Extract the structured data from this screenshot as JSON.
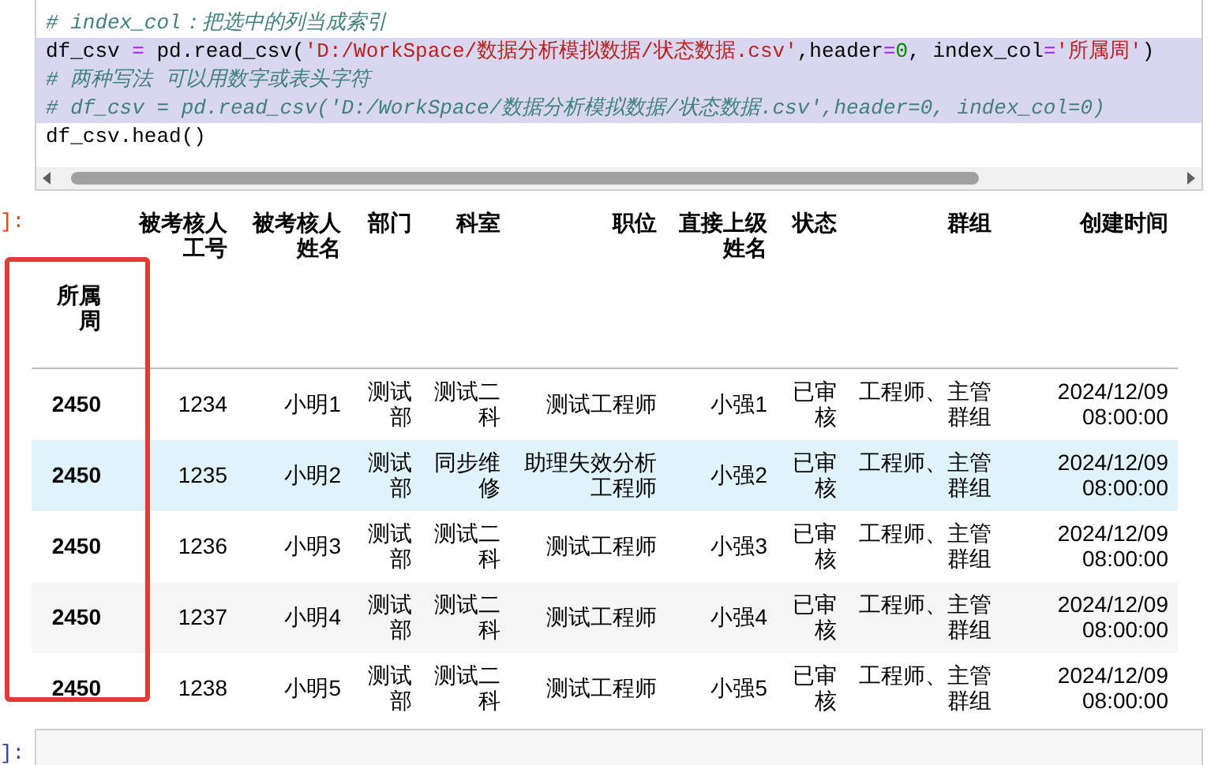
{
  "code_cell": {
    "lines": [
      {
        "selected": false,
        "tokens": [
          {
            "kind": "comment",
            "text": "# index_col：把选中的列当成索引"
          }
        ]
      },
      {
        "selected": true,
        "tokens": [
          {
            "kind": "plain",
            "text": "df_csv "
          },
          {
            "kind": "operator",
            "text": "="
          },
          {
            "kind": "plain",
            "text": " pd.read_csv("
          },
          {
            "kind": "string",
            "text": "'D:/WorkSpace/数据分析模拟数据/状态数据.csv'"
          },
          {
            "kind": "plain",
            "text": ",header"
          },
          {
            "kind": "operator",
            "text": "="
          },
          {
            "kind": "number",
            "text": "0"
          },
          {
            "kind": "plain",
            "text": ", index_col"
          },
          {
            "kind": "operator",
            "text": "="
          },
          {
            "kind": "string",
            "text": "'所属周'"
          },
          {
            "kind": "plain",
            "text": ")"
          }
        ]
      },
      {
        "selected": true,
        "tokens": [
          {
            "kind": "comment",
            "text": "# 两种写法 可以用数字或表头字符"
          }
        ]
      },
      {
        "selected": true,
        "tokens": [
          {
            "kind": "comment",
            "text": "# df_csv = pd.read_csv('D:/WorkSpace/数据分析模拟数据/状态数据.csv',header=0, index_col=0)"
          }
        ]
      },
      {
        "selected": false,
        "tokens": [
          {
            "kind": "plain",
            "text": "df_csv.head()"
          }
        ]
      }
    ]
  },
  "output": {
    "prompt": "]:",
    "table": {
      "columns": [
        "被考核人工号",
        "被考核人姓名",
        "部门",
        "科室",
        "职位",
        "直接上级姓名",
        "状态",
        "群组",
        "创建时间"
      ],
      "index_name": "所属周",
      "rows": [
        {
          "index": "2450",
          "selected": false,
          "cells": [
            "1234",
            "小明1",
            "测试部",
            "测试二科",
            "测试工程师",
            "小强1",
            "已审核",
            "工程师、主管群组",
            "2024/12/09 08:00:00"
          ]
        },
        {
          "index": "2450",
          "selected": true,
          "cells": [
            "1235",
            "小明2",
            "测试部",
            "同步维修",
            "助理失效分析工程师",
            "小强2",
            "已审核",
            "工程师、主管群组",
            "2024/12/09 08:00:00"
          ]
        },
        {
          "index": "2450",
          "selected": false,
          "cells": [
            "1236",
            "小明3",
            "测试部",
            "测试二科",
            "测试工程师",
            "小强3",
            "已审核",
            "工程师、主管群组",
            "2024/12/09 08:00:00"
          ]
        },
        {
          "index": "2450",
          "selected": false,
          "cells": [
            "1237",
            "小明4",
            "测试部",
            "测试二科",
            "测试工程师",
            "小强4",
            "已审核",
            "工程师、主管群组",
            "2024/12/09 08:00:00"
          ]
        },
        {
          "index": "2450",
          "selected": false,
          "cells": [
            "1238",
            "小明5",
            "测试部",
            "测试二科",
            "测试工程师",
            "小强5",
            "已审核",
            "工程师、主管群组",
            "2024/12/09 08:00:00"
          ]
        }
      ]
    }
  },
  "next_cell": {
    "prompt": "]:"
  }
}
